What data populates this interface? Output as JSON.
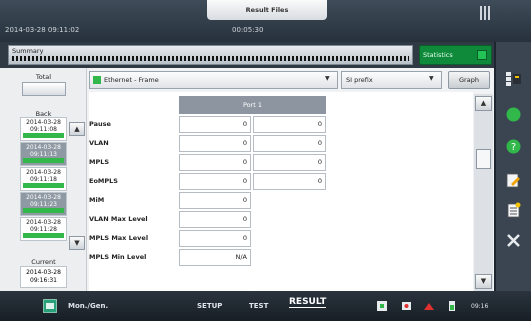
{
  "header": {
    "result_files_label": "Result Files",
    "timestamp": "2014-03-28 09:11:02",
    "elapsed": "00:05:30"
  },
  "summary": {
    "label": "Summary",
    "statistics_label": "Statistics"
  },
  "left_panel": {
    "total_label": "Total",
    "back_label": "Back",
    "entries": [
      {
        "date": "2014-03-28",
        "time": "09:11:08",
        "selected": false
      },
      {
        "date": "2014-03-28",
        "time": "09:11:13",
        "selected": true
      },
      {
        "date": "2014-03-28",
        "time": "09:11:18",
        "selected": false
      },
      {
        "date": "2014-03-28",
        "time": "09:11:23",
        "selected": true
      },
      {
        "date": "2014-03-28",
        "time": "09:11:28",
        "selected": false
      }
    ],
    "current_label": "Current",
    "current_date": "2014-03-28",
    "current_time": "09:16:31"
  },
  "toolbar": {
    "view_selector": "Ethernet - Frame",
    "prefix_selector": "SI prefix",
    "graph_button": "Graph"
  },
  "table": {
    "column_header": "Port 1",
    "rows": [
      {
        "label": "Pause",
        "v1": "0",
        "v2": "0"
      },
      {
        "label": "VLAN",
        "v1": "0",
        "v2": "0"
      },
      {
        "label": "MPLS",
        "v1": "0",
        "v2": "0"
      },
      {
        "label": "EoMPLS",
        "v1": "0",
        "v2": "0"
      },
      {
        "label": "MiM",
        "v1": "0",
        "v2": ""
      },
      {
        "label": "VLAN Max Level",
        "v1": "0",
        "v2": ""
      },
      {
        "label": "MPLS Max Level",
        "v1": "0",
        "v2": ""
      },
      {
        "label": "MPLS Min Level",
        "v1": "N/A",
        "v2": ""
      }
    ]
  },
  "bottom": {
    "mon_gen": "Mon./Gen.",
    "setup": "SETUP",
    "test": "TEST",
    "result": "RESULT",
    "clock": "09:16"
  },
  "colors": {
    "accent_green": "#31b74a",
    "statistics_bg": "#0f8a3a",
    "header_gray": "#8d96a0"
  }
}
